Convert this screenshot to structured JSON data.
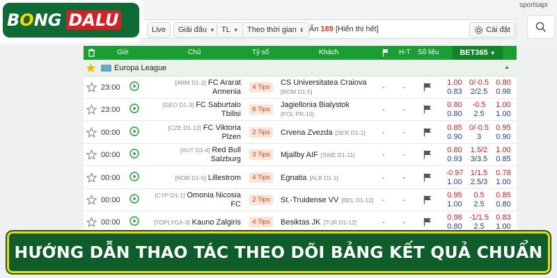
{
  "brand": {
    "left": "B",
    "ball": "O",
    "rest": "NG",
    "right": "DALU"
  },
  "top_right": {
    "label": "sportsapi"
  },
  "filters": {
    "live": "Live",
    "league": "Giải đấu",
    "tl": "TL",
    "time": "Theo thời gian",
    "hidden_prefix": "Ẩn",
    "hidden_count": "189",
    "hidden_suffix": "[Hiển thị hết]",
    "settings": "Cài đặt"
  },
  "header": {
    "time": "Giờ",
    "home": "Chủ",
    "score": "Tỷ số",
    "away": "Khách",
    "ht": "H-T",
    "stats": "Số liệu",
    "bookmaker": "BET365"
  },
  "league": {
    "name": "Europa League"
  },
  "matches": [
    {
      "time": "23:00",
      "home_rank": "[ARM D1-2]",
      "home_l1": "FC Ararat",
      "home_l2": "Armenia",
      "tips": "4 Tips",
      "away_l1": "CS Universitatea Craiova",
      "away_rank": "[ROM D1-5]",
      "away_rank_line": 2,
      "ht_a": "-",
      "ht_b": "-",
      "odds": [
        [
          "1.00",
          "0.83"
        ],
        [
          "0/-0.5",
          "2/2.5"
        ],
        [
          "0.80",
          "0.98"
        ]
      ]
    },
    {
      "time": "23:00",
      "home_rank": "[GEO D1-3]",
      "home_l1": "FC Saburtalo",
      "home_l2": "Tbilisi",
      "tips": "6 Tips",
      "away_l1": "Jagiellonia Bialystok",
      "away_rank": "[POL PR-10]",
      "away_rank_line": 2,
      "ht_a": "-",
      "ht_b": "-",
      "odds": [
        [
          "0.80",
          "0.80"
        ],
        [
          "-0.5",
          "2.5"
        ],
        [
          "1.00",
          "1.00"
        ]
      ]
    },
    {
      "time": "00:00",
      "home_rank": "[CZE D1-12]",
      "home_l1": "FC Viktoria",
      "home_l2": "Plzen",
      "tips": "2 Tips",
      "away_l1": "Crvena Zvezda",
      "away_rank": "[SER D1-1]",
      "away_rank_line": 1,
      "ht_a": "-",
      "ht_b": "-",
      "odds": [
        [
          "0.85",
          "0.90"
        ],
        [
          "0/-0.5",
          "3"
        ],
        [
          "0.95",
          "0.90"
        ]
      ]
    },
    {
      "time": "00:00",
      "home_rank": "[AUT D1-4]",
      "home_l1": "Red Bull",
      "home_l2": "Salzburg",
      "tips": "3 Tips",
      "away_l1": "Mjallby AIF",
      "away_rank": "[SWE D1-11]",
      "away_rank_line": 1,
      "ht_a": "-",
      "ht_b": "-",
      "odds": [
        [
          "0.80",
          "0.93"
        ],
        [
          "1.5/2",
          "3/3.5"
        ],
        [
          "1.00",
          "0.85"
        ]
      ]
    },
    {
      "time": "00:00",
      "home_rank": "[NOR D1-5]",
      "home_l1": "Lillestrom",
      "home_l2": "",
      "tips": "4 Tips",
      "away_l1": "Egnatia",
      "away_rank": "[ALB D1-1]",
      "away_rank_line": 1,
      "ht_a": "-",
      "ht_b": "-",
      "odds": [
        [
          "-0.97",
          "1.00"
        ],
        [
          "1/1.5",
          "2.5/3"
        ],
        [
          "0.78",
          "1.00"
        ]
      ]
    },
    {
      "time": "00:00",
      "home_rank": "[CYP D1-1]",
      "home_l1": "Omonia Nicosia",
      "home_l2": "FC",
      "tips": "2 Tips",
      "away_l1": "St.-Truidense VV",
      "away_rank": "[BEL D1-12]",
      "away_rank_line": 1,
      "ht_a": "-",
      "ht_b": "-",
      "odds": [
        [
          "0.95",
          "1.00"
        ],
        [
          "0.5",
          "2.5"
        ],
        [
          "0.85",
          "0.80"
        ]
      ]
    },
    {
      "time": "00:00",
      "home_rank": "[TOPLYGA-3]",
      "home_l1": "Kauno Zalgiris",
      "home_l2": "",
      "tips": "4 Tips",
      "away_l1": "Besiktas JK",
      "away_rank": "[TUR D1-12]",
      "away_rank_line": 1,
      "ht_a": "-",
      "ht_b": "-",
      "odds": [
        [
          "0.98",
          "0.80"
        ],
        [
          "-1/1.5",
          "2.5"
        ],
        [
          "0.83",
          "1.00"
        ]
      ]
    }
  ],
  "banner": {
    "title": "HƯỚNG DẪN THAO TÁC THEO DÕI BẢNG KẾT QUẢ CHUẨN"
  },
  "colors": {
    "header_green": "#1b9d34",
    "odds_red": "#cf1d1d",
    "odds_blue": "#1b3f9c",
    "banner_green": "#0e5d2b",
    "banner_border": "#ffd400"
  }
}
